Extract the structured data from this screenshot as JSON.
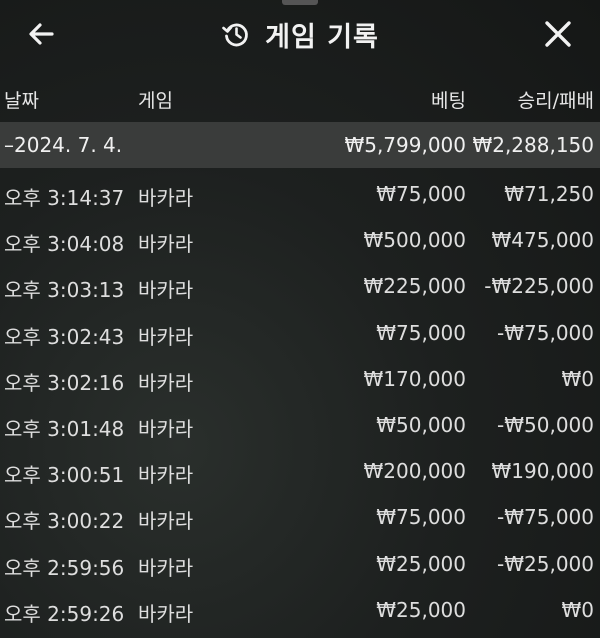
{
  "header": {
    "title": "게임 기록",
    "back_icon": "arrow-left-icon",
    "history_icon": "history-icon",
    "close_icon": "close-icon"
  },
  "columns": {
    "date": "날짜",
    "game": "게임",
    "bet": "베팅",
    "result": "승리/패배"
  },
  "summary": {
    "date": "–2024. 7. 4.",
    "bet": "₩5,799,000",
    "result": "₩2,288,150"
  },
  "records": [
    {
      "time": "오후 3:14:37",
      "game": "바카라",
      "bet": "₩75,000",
      "result": "₩71,250"
    },
    {
      "time": "오후 3:04:08",
      "game": "바카라",
      "bet": "₩500,000",
      "result": "₩475,000"
    },
    {
      "time": "오후 3:03:13",
      "game": "바카라",
      "bet": "₩225,000",
      "result": "-₩225,000"
    },
    {
      "time": "오후 3:02:43",
      "game": "바카라",
      "bet": "₩75,000",
      "result": "-₩75,000"
    },
    {
      "time": "오후 3:02:16",
      "game": "바카라",
      "bet": "₩170,000",
      "result": "₩0"
    },
    {
      "time": "오후 3:01:48",
      "game": "바카라",
      "bet": "₩50,000",
      "result": "-₩50,000"
    },
    {
      "time": "오후 3:00:51",
      "game": "바카라",
      "bet": "₩200,000",
      "result": "₩190,000"
    },
    {
      "time": "오후 3:00:22",
      "game": "바카라",
      "bet": "₩75,000",
      "result": "-₩75,000"
    },
    {
      "time": "오후 2:59:56",
      "game": "바카라",
      "bet": "₩25,000",
      "result": "-₩25,000"
    },
    {
      "time": "오후 2:59:26",
      "game": "바카라",
      "bet": "₩25,000",
      "result": "₩0"
    }
  ]
}
